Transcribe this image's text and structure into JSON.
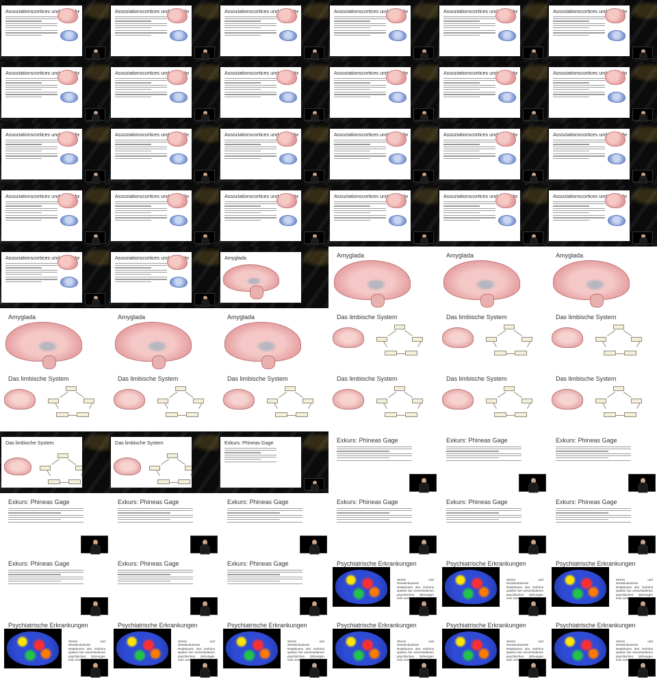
{
  "sheet": {
    "columns": 6,
    "rows": 11,
    "thumb_width": 160,
    "thumb_height": 90,
    "accent_gold": "#c9a03c"
  },
  "slide_titles": {
    "assoc": "Assoziationscortices und Bereiche",
    "amyg": "Amyglada",
    "limbic": "Das limbische System",
    "phineas": "Exkurs: Phineas Gage",
    "psych": "Psychiatrische Erkrankungen"
  },
  "psych_text": "Stress und stressinduzierte Reaktionen des Gehirns spielen bei verschiedenen psychischen Störungen eine zentrale Rolle",
  "frames": [
    {
      "type": "assoc",
      "frame": "dark"
    },
    {
      "type": "assoc",
      "frame": "dark"
    },
    {
      "type": "assoc",
      "frame": "dark"
    },
    {
      "type": "assoc",
      "frame": "dark"
    },
    {
      "type": "assoc",
      "frame": "dark"
    },
    {
      "type": "assoc",
      "frame": "dark"
    },
    {
      "type": "assoc",
      "frame": "dark"
    },
    {
      "type": "assoc",
      "frame": "dark"
    },
    {
      "type": "assoc",
      "frame": "dark"
    },
    {
      "type": "assoc",
      "frame": "dark"
    },
    {
      "type": "assoc",
      "frame": "dark"
    },
    {
      "type": "assoc",
      "frame": "dark"
    },
    {
      "type": "assoc",
      "frame": "dark"
    },
    {
      "type": "assoc",
      "frame": "dark"
    },
    {
      "type": "assoc",
      "frame": "dark"
    },
    {
      "type": "assoc",
      "frame": "dark"
    },
    {
      "type": "assoc",
      "frame": "dark"
    },
    {
      "type": "assoc",
      "frame": "dark"
    },
    {
      "type": "assoc",
      "frame": "dark"
    },
    {
      "type": "assoc",
      "frame": "dark"
    },
    {
      "type": "assoc",
      "frame": "dark"
    },
    {
      "type": "assoc",
      "frame": "dark"
    },
    {
      "type": "assoc",
      "frame": "dark"
    },
    {
      "type": "assoc",
      "frame": "dark"
    },
    {
      "type": "assoc",
      "frame": "dark"
    },
    {
      "type": "assoc",
      "frame": "dark"
    },
    {
      "type": "amyg",
      "frame": "dark"
    },
    {
      "type": "amyg",
      "frame": "light"
    },
    {
      "type": "amyg",
      "frame": "light"
    },
    {
      "type": "amyg",
      "frame": "light"
    },
    {
      "type": "amyg",
      "frame": "light"
    },
    {
      "type": "amyg",
      "frame": "light"
    },
    {
      "type": "amyg",
      "frame": "light"
    },
    {
      "type": "limbic",
      "frame": "light"
    },
    {
      "type": "limbic",
      "frame": "light"
    },
    {
      "type": "limbic",
      "frame": "light"
    },
    {
      "type": "limbic",
      "frame": "light"
    },
    {
      "type": "limbic",
      "frame": "light"
    },
    {
      "type": "limbic",
      "frame": "light"
    },
    {
      "type": "limbic",
      "frame": "light"
    },
    {
      "type": "limbic",
      "frame": "light"
    },
    {
      "type": "limbic",
      "frame": "light"
    },
    {
      "type": "limbic",
      "frame": "dark"
    },
    {
      "type": "limbic",
      "frame": "dark"
    },
    {
      "type": "phineas",
      "frame": "dark"
    },
    {
      "type": "phineas",
      "frame": "light"
    },
    {
      "type": "phineas",
      "frame": "light"
    },
    {
      "type": "phineas",
      "frame": "light"
    },
    {
      "type": "phineas",
      "frame": "light"
    },
    {
      "type": "phineas",
      "frame": "light"
    },
    {
      "type": "phineas",
      "frame": "light"
    },
    {
      "type": "phineas",
      "frame": "light"
    },
    {
      "type": "phineas",
      "frame": "light"
    },
    {
      "type": "phineas",
      "frame": "light"
    },
    {
      "type": "phineas",
      "frame": "light"
    },
    {
      "type": "phineas",
      "frame": "light"
    },
    {
      "type": "phineas",
      "frame": "light"
    },
    {
      "type": "psych",
      "frame": "light"
    },
    {
      "type": "psych",
      "frame": "light"
    },
    {
      "type": "psych",
      "frame": "light"
    },
    {
      "type": "psych",
      "frame": "light"
    },
    {
      "type": "psych",
      "frame": "light"
    },
    {
      "type": "psych",
      "frame": "light"
    },
    {
      "type": "psych",
      "frame": "light"
    },
    {
      "type": "psych",
      "frame": "light"
    },
    {
      "type": "psych",
      "frame": "light"
    }
  ]
}
